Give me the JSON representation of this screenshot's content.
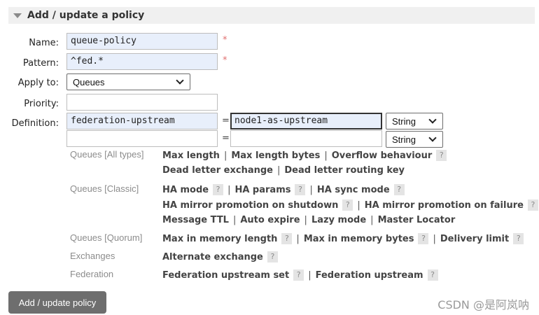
{
  "section": {
    "title": "Add / update a policy"
  },
  "form": {
    "name": {
      "label": "Name:",
      "value": "queue-policy",
      "required_mark": "*"
    },
    "pattern": {
      "label": "Pattern:",
      "value": "^fed.*",
      "required_mark": "*"
    },
    "apply_to": {
      "label": "Apply to:",
      "selected": "Queues"
    },
    "priority": {
      "label": "Priority:",
      "value": ""
    },
    "definition": {
      "label": "Definition:",
      "rows": [
        {
          "key": "federation-upstream",
          "equals": "=",
          "value": "node1-as-upstream",
          "type": "String"
        },
        {
          "key": "",
          "equals": "=",
          "value": "",
          "type": "String"
        }
      ]
    }
  },
  "hints": {
    "queues_all": {
      "category": "Queues [All types]",
      "line1": [
        "Max length",
        "Max length bytes",
        "Overflow behaviour"
      ],
      "line2": [
        "Dead letter exchange",
        "Dead letter routing key"
      ]
    },
    "queues_classic": {
      "category": "Queues [Classic]",
      "line1": [
        "HA mode",
        "HA params",
        "HA sync mode"
      ],
      "line2": [
        "HA mirror promotion on shutdown",
        "HA mirror promotion on failure"
      ],
      "line3": [
        "Message TTL",
        "Auto expire",
        "Lazy mode",
        "Master Locator"
      ]
    },
    "queues_quorum": {
      "category": "Queues [Quorum]",
      "line1": [
        "Max in memory length",
        "Max in memory bytes",
        "Delivery limit"
      ]
    },
    "exchanges": {
      "category": "Exchanges",
      "line1": [
        "Alternate exchange"
      ]
    },
    "federation": {
      "category": "Federation",
      "line1": [
        "Federation upstream set",
        "Federation upstream"
      ]
    },
    "help_glyph": "?",
    "separator": "|"
  },
  "submit": {
    "label": "Add / update policy"
  },
  "watermark": {
    "text": "CSDN @是阿岚呐"
  }
}
